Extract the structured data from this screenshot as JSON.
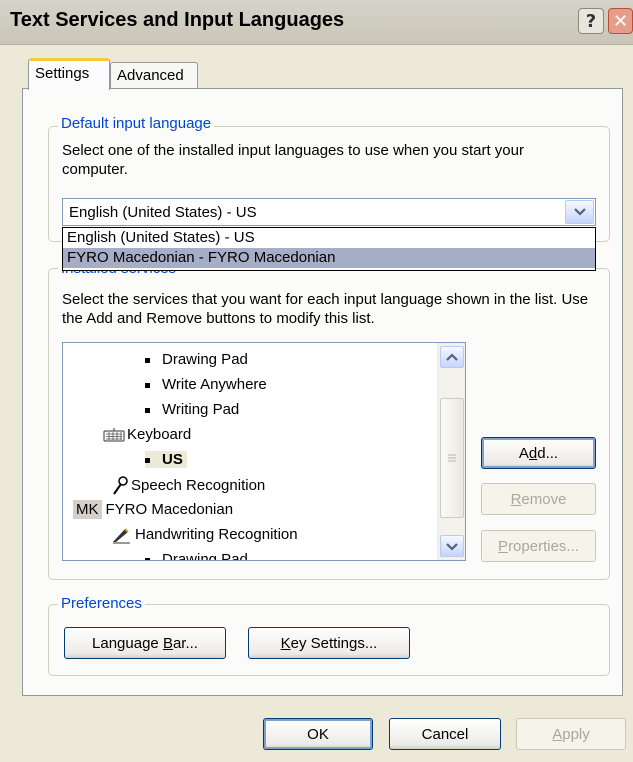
{
  "window": {
    "title": "Text Services and Input Languages",
    "help_label": "?",
    "close_label": "✕"
  },
  "tabs": [
    {
      "label": "Settings"
    },
    {
      "label": "Advanced"
    }
  ],
  "default_input": {
    "legend": "Default input language",
    "legend_mnemonic": "l",
    "description": "Select one of the installed input languages to use when you start your computer.",
    "selected_value": "English (United States) - US",
    "options": [
      "English (United States) - US",
      "FYRO Macedonian - FYRO Macedonian"
    ]
  },
  "installed_services": {
    "legend": "Installed services",
    "description": "Select the services that you want for each input language shown in the list. Use the Add and Remove buttons to modify this list.",
    "items": [
      {
        "label": "Drawing Pad"
      },
      {
        "label": "Write Anywhere"
      },
      {
        "label": "Writing Pad"
      },
      {
        "label": "Keyboard",
        "icon": "keyboard-icon"
      },
      {
        "label": "US"
      },
      {
        "label": "Speech Recognition",
        "icon": "microphone-icon"
      },
      {
        "label": "FYRO Macedonian",
        "badge": "MK"
      },
      {
        "label": "Handwriting Recognition",
        "icon": "pen-icon"
      },
      {
        "label": "Drawing Pad"
      }
    ],
    "buttons": {
      "add": {
        "pre": "A",
        "mn": "d",
        "post": "d..."
      },
      "remove": {
        "pre": "",
        "mn": "R",
        "post": "emove"
      },
      "properties": {
        "pre": "",
        "mn": "P",
        "post": "roperties..."
      }
    }
  },
  "preferences": {
    "legend": "Preferences",
    "language_bar": {
      "pre": "Language ",
      "mn": "B",
      "post": "ar..."
    },
    "key_settings": {
      "pre": "",
      "mn": "K",
      "post": "ey Settings..."
    }
  },
  "dialog_buttons": {
    "ok": "OK",
    "cancel": "Cancel",
    "apply": {
      "pre": "",
      "mn": "A",
      "post": "pply"
    }
  }
}
